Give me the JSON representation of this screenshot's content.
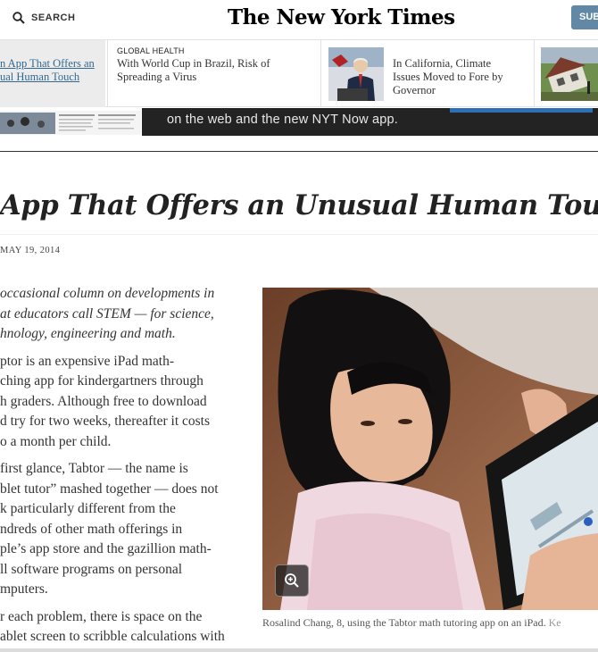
{
  "header": {
    "search_label": "SEARCH",
    "masthead": "The New York Times",
    "subscribe_label": "SUB"
  },
  "story_strip": [
    {
      "kicker": "",
      "headline_lines": [
        "n App That Offers an",
        "ual Human Touch"
      ],
      "active": true
    },
    {
      "kicker": "GLOBAL HEALTH",
      "headline_lines": [
        "With World Cup in Brazil, Risk of",
        "Spreading a Virus"
      ],
      "active": false
    },
    {
      "kicker": "",
      "headline_lines": [
        "In California, Climate",
        "Issues Moved to Fore by",
        "Governor"
      ],
      "active": false
    }
  ],
  "ad": {
    "text": "on the web and the new NYT Now app."
  },
  "article": {
    "headline": "App That Offers an Unusual Human Tou",
    "dateline": "MAY 19, 2014",
    "paragraphs": [
      {
        "italic": true,
        "lines": [
          "occasional column on developments in",
          "at educators call STEM — for science,",
          "hnology, engineering and math."
        ]
      },
      {
        "italic": false,
        "lines": [
          "ptor is an expensive iPad math-",
          "ching app for kindergartners through",
          "h graders. Although free to download",
          "d try for two weeks, thereafter it costs",
          "o a month per child."
        ]
      },
      {
        "italic": false,
        "lines": [
          "first glance, Tabtor — the name is",
          "blet tutor” mashed together — does not",
          "k particularly different from the",
          "ndreds of other math offerings in",
          "ple’s app store and the gazillion math-",
          "ll software programs on personal",
          "mputers."
        ]
      },
      {
        "italic": false,
        "lines": [
          "r each problem, there is space on the",
          "ablet screen to scribble calculations with"
        ]
      }
    ],
    "caption": "Rosalind Chang, 8, using the Tabtor math tutoring app on an iPad.",
    "caption_credit": "Ke"
  },
  "icons": {
    "search": "search-icon",
    "zoom": "zoom-in-icon"
  },
  "colors": {
    "link": "#326891",
    "subscribe": "#6288a5",
    "ad_background": "#232323"
  }
}
